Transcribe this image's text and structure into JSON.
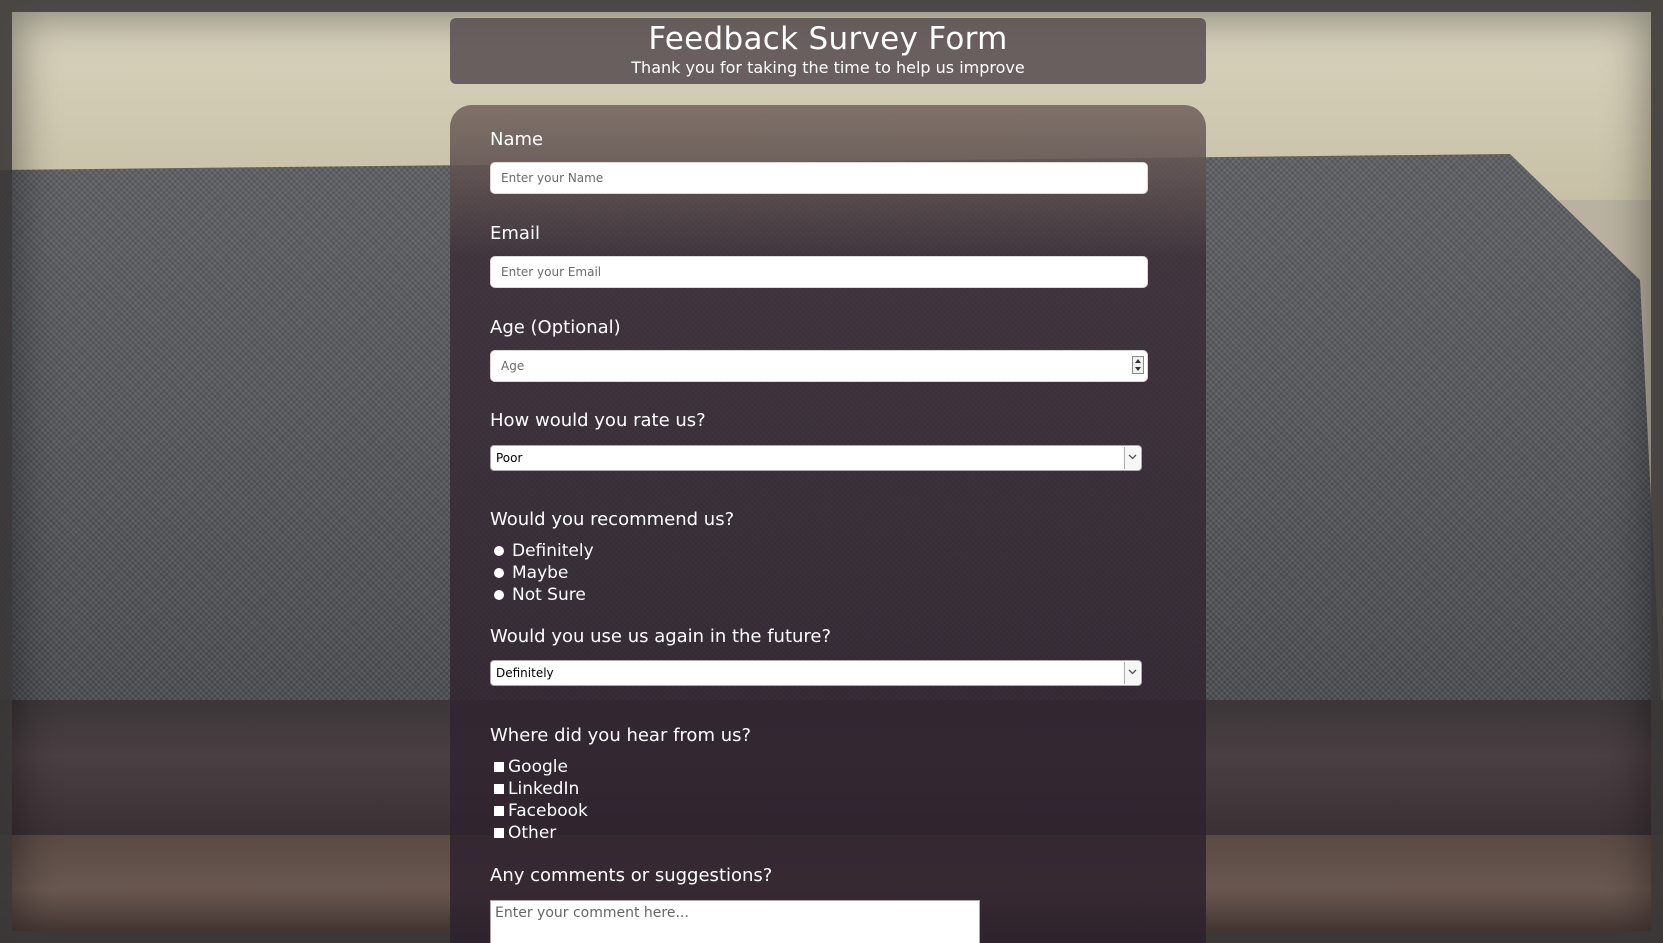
{
  "header": {
    "title": "Feedback Survey Form",
    "subtitle": "Thank you for taking the time to help us improve"
  },
  "form": {
    "name": {
      "label": "Name",
      "placeholder": "Enter your Name"
    },
    "email": {
      "label": "Email",
      "placeholder": "Enter your Email"
    },
    "age": {
      "label": "Age (Optional)",
      "placeholder": "Age"
    },
    "rating": {
      "label": "How would you rate us?",
      "selected": "Poor"
    },
    "recommend": {
      "label": "Would you recommend us?",
      "options": [
        "Definitely",
        "Maybe",
        "Not Sure"
      ]
    },
    "use_again": {
      "label": "Would you use us again in the future?",
      "selected": "Definitely"
    },
    "heard_from": {
      "label": "Where did you hear from us?",
      "options": [
        "Google",
        "LinkedIn",
        "Facebook",
        "Other"
      ]
    },
    "comments": {
      "label": "Any comments or suggestions?",
      "placeholder": "Enter your comment here..."
    }
  },
  "icons": {
    "select_arrow": "chevron-down-icon",
    "spinner": "spinner-arrows-icon"
  }
}
